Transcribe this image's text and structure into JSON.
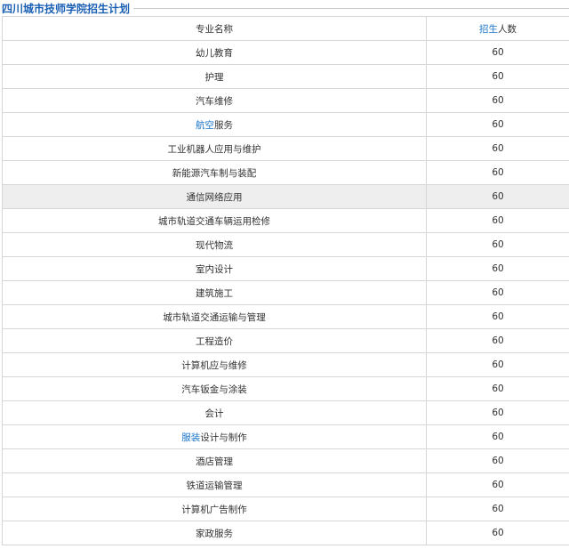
{
  "page_title": "四川城市技师学院招生计划",
  "header": {
    "name_label": "专业名称",
    "count_label_link": "招生",
    "count_label_rest": "人数"
  },
  "rows": [
    {
      "name": "幼儿教育",
      "count": "60"
    },
    {
      "name": "护理",
      "count": "60"
    },
    {
      "name": "汽车维修",
      "count": "60"
    },
    {
      "name_link": "航空",
      "name_rest": "服务",
      "count": "60"
    },
    {
      "name": "工业机器人应用与维护",
      "count": "60"
    },
    {
      "name": "新能源汽车制与装配",
      "count": "60"
    },
    {
      "name": "通信网络应用",
      "count": "60",
      "highlighted": true
    },
    {
      "name": "城市轨道交通车辆运用检修",
      "count": "60"
    },
    {
      "name": "现代物流",
      "count": "60"
    },
    {
      "name": "室内设计",
      "count": "60"
    },
    {
      "name": "建筑施工",
      "count": "60"
    },
    {
      "name": "城市轨道交通运输与管理",
      "count": "60"
    },
    {
      "name": "工程造价",
      "count": "60"
    },
    {
      "name": "计算机应与维修",
      "count": "60"
    },
    {
      "name": "汽车钣金与涂装",
      "count": "60"
    },
    {
      "name": "会计",
      "count": "60"
    },
    {
      "name_link": "服装",
      "name_rest": "设计与制作",
      "count": "60"
    },
    {
      "name": "酒店管理",
      "count": "60"
    },
    {
      "name": "铁道运输管理",
      "count": "60"
    },
    {
      "name": "计算机广告制作",
      "count": "60"
    },
    {
      "name": "家政服务",
      "count": "60"
    }
  ],
  "colors": {
    "title": "#1a5fb4",
    "link": "#1a73c8",
    "border": "#d6d6d6",
    "highlight_row": "#eeeeee"
  }
}
